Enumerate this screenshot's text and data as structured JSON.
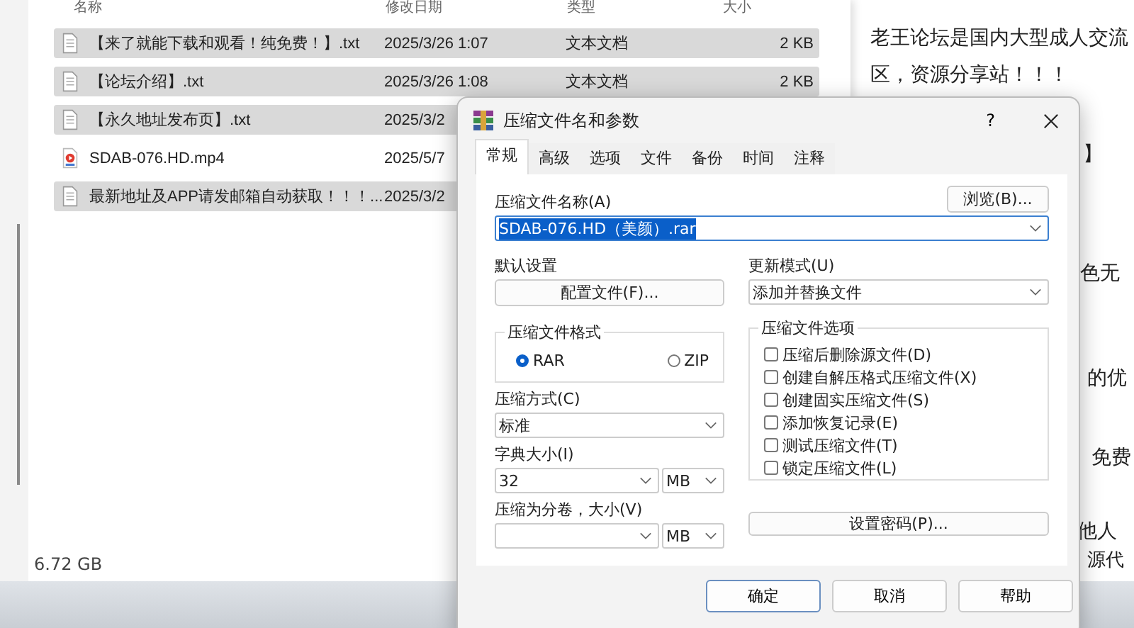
{
  "explorer": {
    "columns": [
      "名称",
      "修改日期",
      "类型",
      "大小"
    ],
    "rows": [
      {
        "kind": "text",
        "name": "【来了就能下载和观看！纯免费！】.txt",
        "date": "2025/3/26 1:07",
        "type": "文本文档",
        "size": "2 KB",
        "selected": true
      },
      {
        "kind": "text",
        "name": "【论坛介绍】.txt",
        "date": "2025/3/26 1:08",
        "type": "文本文档",
        "size": "2 KB",
        "selected": true
      },
      {
        "kind": "text",
        "name": "【永久地址发布页】.txt",
        "date": "2025/3/2",
        "selected": true
      },
      {
        "kind": "video",
        "name": "SDAB-076.HD.mp4",
        "date": "2025/5/7",
        "selected": false
      },
      {
        "kind": "text",
        "name": "最新地址及APP请发邮箱自动获取！！！...",
        "date": "2025/3/2",
        "selected": true
      }
    ],
    "status": "6.72 GB"
  },
  "document": {
    "lines": [
      {
        "text": "老王论坛是国内大型成人交流"
      },
      {
        "text": "区，资源分享站！！！"
      },
      {
        "text": "】"
      },
      {
        "text": "色无"
      },
      {
        "text": "的优"
      },
      {
        "text": "免费"
      },
      {
        "text": "他人"
      },
      {
        "text": "源代"
      }
    ]
  },
  "dialog": {
    "title": "压缩文件名和参数",
    "help": "?",
    "tabs": [
      {
        "label": "常规",
        "selected": true
      },
      {
        "label": "高级",
        "selected": false
      },
      {
        "label": "选项",
        "selected": false
      },
      {
        "label": "文件",
        "selected": false
      },
      {
        "label": "备份",
        "selected": false
      },
      {
        "label": "时间",
        "selected": false
      },
      {
        "label": "注释",
        "selected": false
      }
    ],
    "archive_name_label": "压缩文件名称(A)",
    "browse_button": "浏览(B)...",
    "archive_name": "SDAB-076.HD（美颜）.rar",
    "profiles_label": "默认设置",
    "profiles_button": "配置文件(F)...",
    "update_mode_label": "更新模式(U)",
    "update_mode": "添加并替换文件",
    "format": {
      "label": "压缩文件格式",
      "options": [
        {
          "label": "RAR",
          "selected": true
        },
        {
          "label": "ZIP",
          "selected": false
        }
      ]
    },
    "method_label": "压缩方式(C)",
    "method": "标准",
    "dictionary_label": "字典大小(I)",
    "dictionary": "32",
    "dictionary_unit": "MB",
    "volume_label": "压缩为分卷，大小(V)",
    "volume_unit": "MB",
    "options": {
      "label": "压缩文件选项",
      "items": [
        {
          "label": "压缩后删除源文件(D)",
          "checked": false
        },
        {
          "label": "创建自解压格式压缩文件(X)",
          "checked": false
        },
        {
          "label": "创建固实压缩文件(S)",
          "checked": false
        },
        {
          "label": "添加恢复记录(E)",
          "checked": false
        },
        {
          "label": "测试压缩文件(T)",
          "checked": false
        },
        {
          "label": "锁定压缩文件(L)",
          "checked": false
        }
      ]
    },
    "password_button": "设置密码(P)...",
    "buttons": [
      {
        "label": "确定",
        "default": true
      },
      {
        "label": "取消",
        "default": false
      },
      {
        "label": "帮助",
        "default": false
      }
    ]
  }
}
